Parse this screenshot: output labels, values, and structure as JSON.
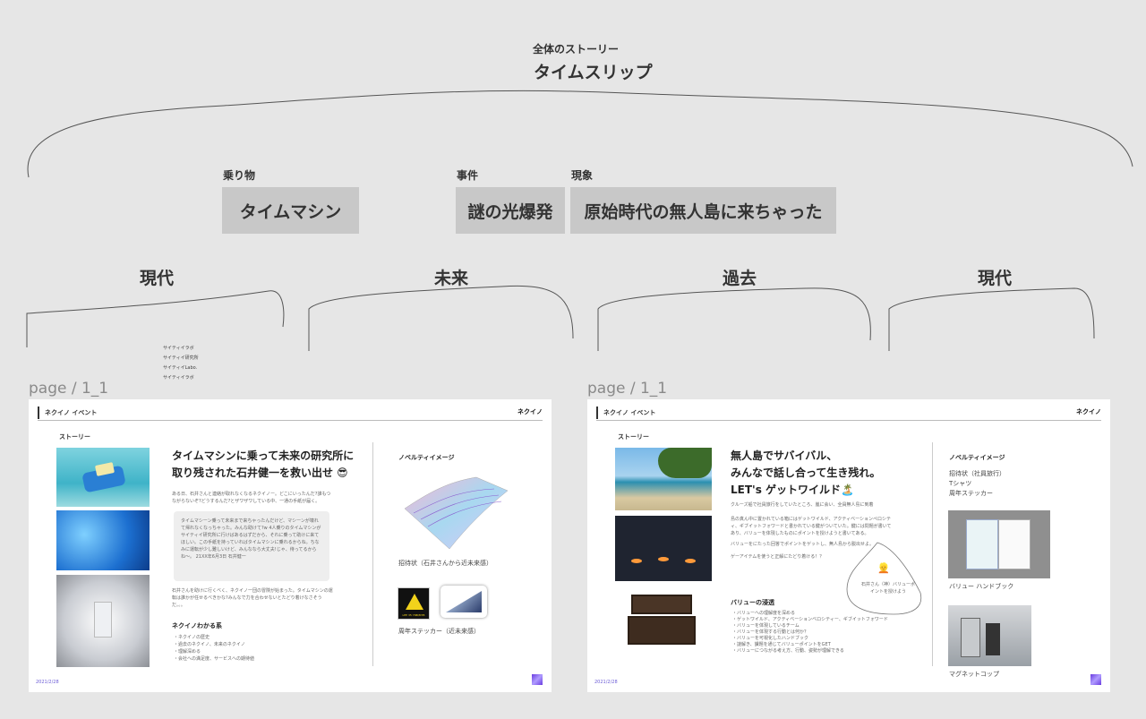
{
  "overall": {
    "caption": "全体のストーリー",
    "title": "タイムスリップ"
  },
  "story_elements": [
    {
      "caption": "乗り物",
      "value": "タイムマシン"
    },
    {
      "caption": "事件",
      "value": "謎の光爆発"
    },
    {
      "caption": "現象",
      "value": "原始時代の無人島に来ちゃった"
    }
  ],
  "eras": [
    "現代",
    "未来",
    "過去",
    "現代"
  ],
  "side_menu": [
    "サイティイラボ",
    "サイティイ研究所",
    "サイティイLabo.",
    "サイティイラボ"
  ],
  "pages": [
    {
      "label": "page / 1_1",
      "header": "ネクイノ イベント",
      "logo": "ネクイノ",
      "section": "ストーリー",
      "headline": "タイムマシンに乗って未来の研究所に取り残された石井健一を救い出せ 😎",
      "intro": "ある日、石井さんと連絡が取れなくなるネクイノー。どこにいったんだ?誰もつながらないぞ?どうするんだ?とザワザワしている中、一通の手紙が届く。",
      "quote": "タイムマシーン乗って未来まで来ちゃったんだけど、マシーンが壊れて帰れなくなっちゃった。みんな助けて?w 4人乗りのタイムマシンがサイティイ研究所に行けばあるはずだから、それに乗って助けに来てほしい。この手紙を持っていればタイムマシンに乗れるからね。ちなみに運転が少し難しいけど、みんななら大丈夫!じゃ、待ってるからね〜。 21XX年6月3日 石井健一",
      "outro": "石井さんを助けに行くべく、ネクイノ一団の冒険が始まった。タイムマシンの運転は誰かが任せるべきかな?みんなで力を合わせないとたどり着けなさそうだ。。。",
      "sub_title": "ネクイノわかる系",
      "sub_items": [
        "ネクイノの歴史",
        "過去のネクイノ、未来のネクイノ",
        "理解深める",
        "会社への満足度、サービスへの期待値"
      ],
      "novelty_title": "ノベルティイメージ",
      "novelty_items": [
        "招待状（石井さんから近未来感）",
        "周年ステッカー（近未来感）"
      ],
      "footer": "2021/2/28",
      "sticker_text": "LEE 35 YNB/M7B"
    },
    {
      "label": "page / 1_1",
      "header": "ネクイノ イベント",
      "logo": "ネクイノ",
      "section": "ストーリー",
      "headline_lines": [
        "無人島でサバイバル、",
        "みんなで話し合って生き残れ。",
        "LET's ゲットワイルド🏝️"
      ],
      "intro": "クルーズ船で社員旅行をしていたところ、嵐に会い、全員無人島に到着",
      "body1": "島の真ん中に置かれている箱にはゲットワイルド、アクティベーションペロシティ、ギブイットフォワードと書かれている鍵がついていた。鍵には問題が書いてあり、バリューを体現したものにポイントを授けようと書いてある。",
      "body2": "バリューをにたった回答でポイントをゲットし、無人島から脱出せよ。",
      "body3": "ゲーアイテムを使うと正解にたどり着ける！？",
      "bubble_emoji": "👱",
      "bubble_text": "石井さん（神）バリューポイントを授けよう",
      "sub_title": "バリューの浸透",
      "sub_items": [
        "バリューへの理解度を深める",
        "ゲットワイルド、アクティベーションベロシティー、ギブイットフォワード",
        "バリューを体現しているチーム",
        "バリューを体現する行動とは何か？",
        "バリューを可視化したハンドブック",
        "謎解き、課題を通じてバリューポイントをGET",
        "バリューにつながる考え方、行動、姿勢が理解できる"
      ],
      "novelty_title": "ノベルティイメージ",
      "novelty_list": [
        "招待状（社員旅行）",
        "Tシャツ",
        "周年ステッカー"
      ],
      "img_captions": [
        "バリュー ハンドブック",
        "マグネットコップ"
      ],
      "footer": "2021/2/28"
    }
  ]
}
